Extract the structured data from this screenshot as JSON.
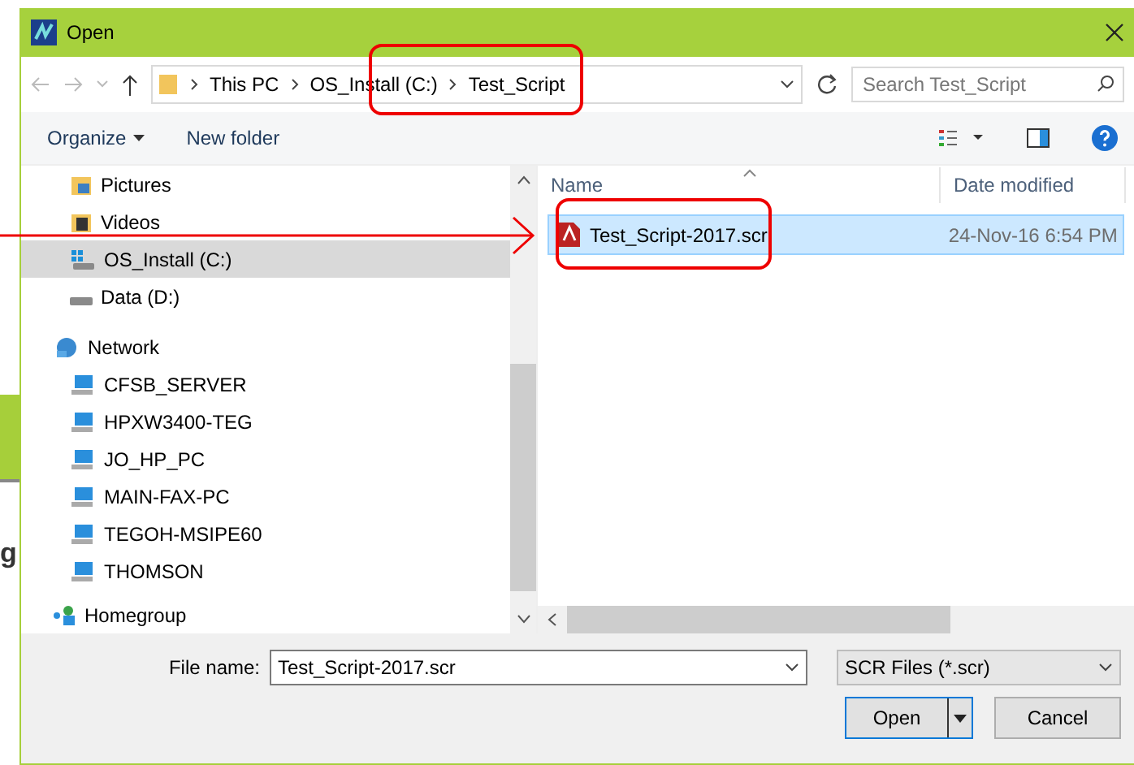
{
  "backdrop": {
    "text": "g"
  },
  "window": {
    "title": "Open"
  },
  "address": {
    "crumbs": [
      "This PC",
      "OS_Install (C:)",
      "Test_Script"
    ],
    "search_placeholder": "Search Test_Script"
  },
  "toolbar": {
    "organize": "Organize",
    "new_folder": "New folder"
  },
  "nav": {
    "items": [
      {
        "label": "Pictures",
        "kind": "pictures",
        "selected": false
      },
      {
        "label": "Videos",
        "kind": "videos",
        "selected": false
      },
      {
        "label": "OS_Install (C:)",
        "kind": "system-drive",
        "selected": true
      },
      {
        "label": "Data (D:)",
        "kind": "drive",
        "selected": false
      },
      {
        "label": "Network",
        "kind": "network",
        "selected": false,
        "children": [
          {
            "label": "CFSB_SERVER",
            "kind": "computer",
            "selected": false
          },
          {
            "label": "HPXW3400-TEG",
            "kind": "computer",
            "selected": false
          },
          {
            "label": "JO_HP_PC",
            "kind": "computer",
            "selected": false
          },
          {
            "label": "MAIN-FAX-PC",
            "kind": "computer",
            "selected": false
          },
          {
            "label": "TEGOH-MSIPE60",
            "kind": "computer",
            "selected": false
          },
          {
            "label": "THOMSON",
            "kind": "computer",
            "selected": false
          }
        ]
      },
      {
        "label": "Homegroup",
        "kind": "homegroup",
        "selected": false
      }
    ]
  },
  "files": {
    "columns": [
      "Name",
      "Date modified"
    ],
    "rows": [
      {
        "name": "Test_Script-2017.scr",
        "date": "24-Nov-16 6:54 PM",
        "selected": true
      }
    ]
  },
  "footer": {
    "file_name_label": "File name:",
    "file_name": "Test_Script-2017.scr",
    "file_type": "SCR Files (*.scr)",
    "open": "Open",
    "cancel": "Cancel"
  }
}
